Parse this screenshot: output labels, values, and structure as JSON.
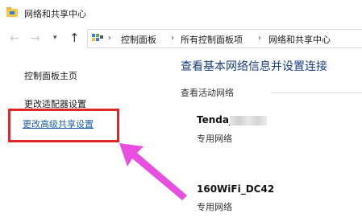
{
  "window": {
    "title": "网络和共享中心"
  },
  "nav": {
    "back": "←",
    "forward": "→",
    "recent": "▾",
    "up": "↑"
  },
  "breadcrumb": {
    "items": [
      "控制面板",
      "所有控制面板项",
      "网络和共享中心"
    ],
    "separator": "›",
    "lead": "›"
  },
  "sidebar": {
    "items": [
      {
        "label": "控制面板主页"
      },
      {
        "label": "更改适配器设置"
      },
      {
        "label": "更改高级共享设置"
      }
    ]
  },
  "main": {
    "heading": "查看基本网络信息并设置连接",
    "active_networks_label": "查看活动网络",
    "networks": [
      {
        "name": "Tenda_",
        "type": "专用网络"
      },
      {
        "name": "160WiFi_DC42",
        "type": "专用网络"
      }
    ]
  },
  "colors": {
    "highlight_box": "#e0262b",
    "arrow": "#e84fe0",
    "link": "#1e5fa8",
    "heading": "#1a3d7c"
  }
}
